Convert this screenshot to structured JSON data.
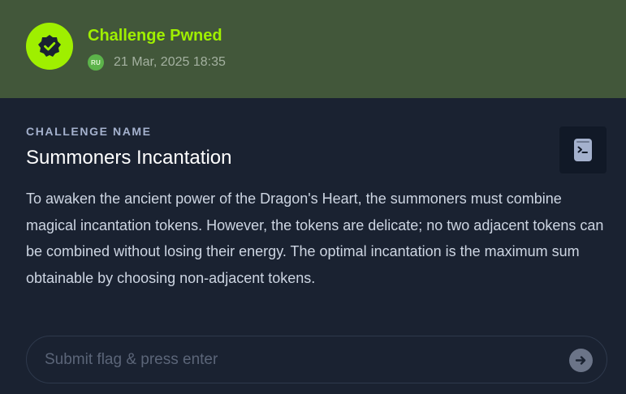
{
  "header": {
    "status_title": "Challenge Pwned",
    "badge_icon": "verified-check-icon",
    "avatar_initials": "RU",
    "timestamp": "21 Mar, 2025 18:35"
  },
  "challenge": {
    "section_label": "CHALLENGE NAME",
    "name": "Summoners Incantation",
    "description": "To awaken the ancient power of the Dragon's Heart, the summoners must combine magical incantation tokens. However, the tokens are delicate; no two adjacent tokens can be combined without losing their energy. The optimal incantation is the maximum sum obtainable by choosing non-adjacent tokens.",
    "action_icon": "terminal-doc-icon"
  },
  "flag": {
    "value": "",
    "placeholder": "Submit flag & press enter",
    "submit_icon": "arrow-right-icon"
  },
  "colors": {
    "header_bg": "#42573a",
    "accent": "#9fef00",
    "body_bg": "#1a2231",
    "terminal_bg": "#111927"
  }
}
